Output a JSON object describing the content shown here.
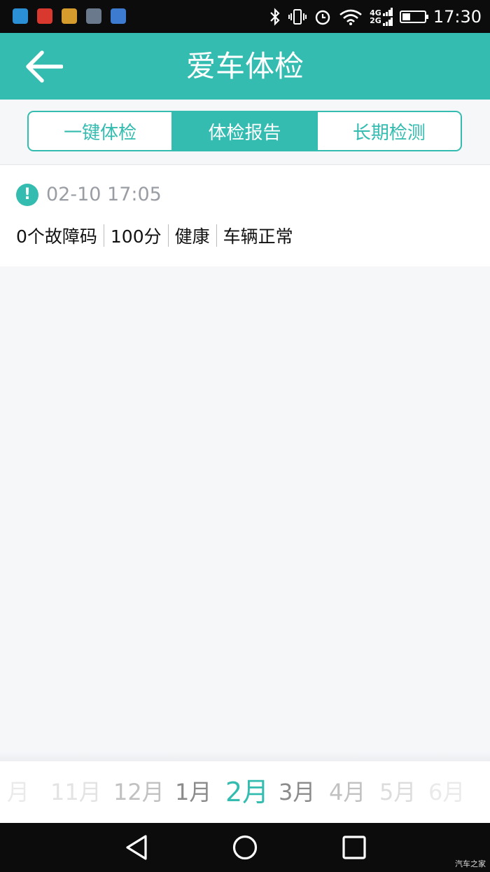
{
  "status_bar": {
    "time": "17:30",
    "network_top": "4G",
    "network_bottom": "2G",
    "battery_level": 0.35,
    "app_icon_colors": [
      "#2b8fd6",
      "#d9382e",
      "#d69b2d",
      "#6a7a8c",
      "#3d7bd1"
    ]
  },
  "header": {
    "title": "爱车体检"
  },
  "tabs": [
    {
      "label": "一键体检",
      "active": false
    },
    {
      "label": "体检报告",
      "active": true
    },
    {
      "label": "长期检测",
      "active": false
    }
  ],
  "report": {
    "timestamp": "02-10 17:05",
    "fault_codes": "0个故障码",
    "score": "100分",
    "health": "健康",
    "vehicle_status": "车辆正常"
  },
  "months": [
    {
      "label": "月",
      "opacity": 0.15
    },
    {
      "label": "11月",
      "opacity": 0.2
    },
    {
      "label": "12月",
      "opacity": 0.45
    },
    {
      "label": "1月",
      "opacity": 0.85
    },
    {
      "label": "2月",
      "selected": true,
      "opacity": 1
    },
    {
      "label": "3月",
      "opacity": 0.85
    },
    {
      "label": "4月",
      "opacity": 0.45
    },
    {
      "label": "5月",
      "opacity": 0.25
    },
    {
      "label": "6月",
      "opacity": 0.15
    }
  ],
  "watermark": "汽车之家",
  "colors": {
    "accent": "#34bcb0",
    "background": "#f6f7f9",
    "bars": "#0c0c0c"
  }
}
